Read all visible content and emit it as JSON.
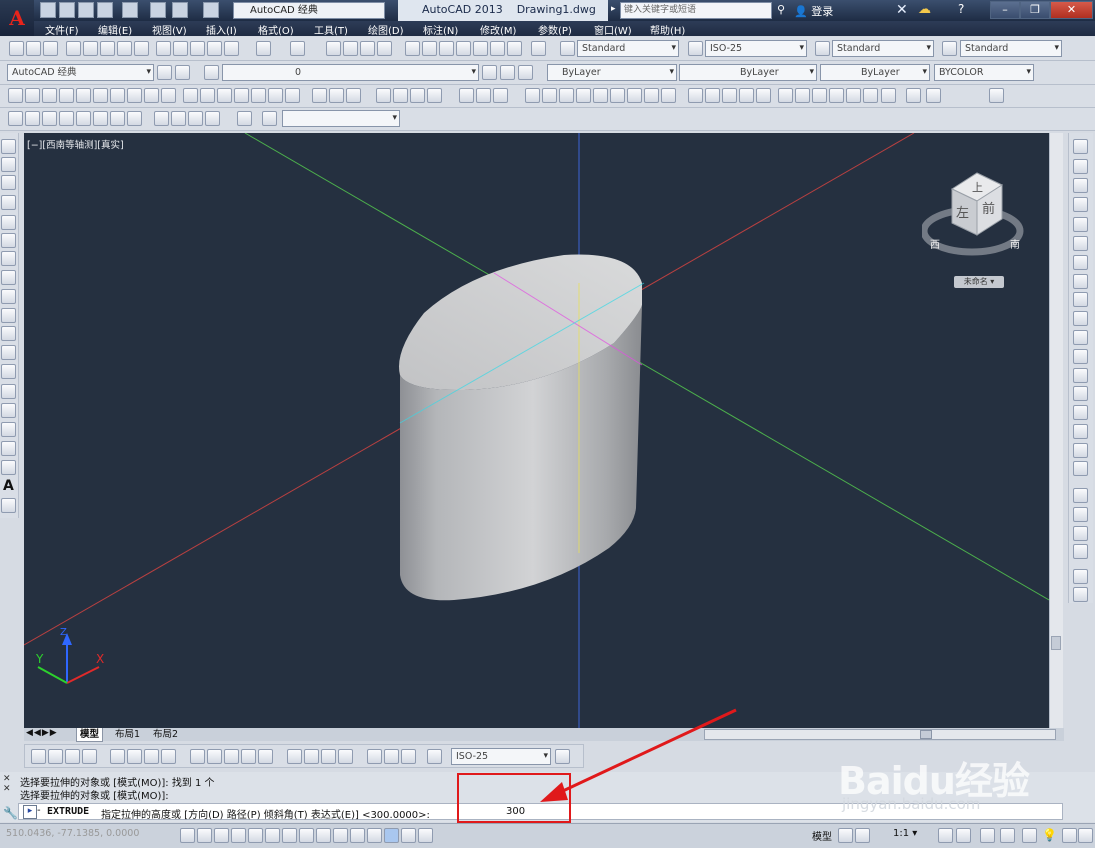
{
  "titlebar": {
    "workspace_combo": "AutoCAD 经典",
    "app_title": "AutoCAD 2013    Drawing1.dwg",
    "search_placeholder": "键入关键字或短语",
    "login": "登录"
  },
  "menubar": {
    "items": [
      "文件(F)",
      "编辑(E)",
      "视图(V)",
      "插入(I)",
      "格式(O)",
      "工具(T)",
      "绘图(D)",
      "标注(N)",
      "修改(M)",
      "参数(P)",
      "窗口(W)",
      "帮助(H)"
    ]
  },
  "styles_toolbar": {
    "text_style": "Standard",
    "dim_style": "ISO-25",
    "table_style": "Standard",
    "multileader_style": "Standard"
  },
  "layers_toolbar": {
    "workspace": "AutoCAD 经典",
    "layer": "0",
    "color": "ByLayer",
    "linetype": "ByLayer",
    "lineweight": "ByLayer",
    "plotstyle": "BYCOLOR"
  },
  "viewport": {
    "label": "[−][西南等轴测][真实]",
    "viewcube": {
      "top": "上",
      "left": "左",
      "front": "前",
      "compass_w": "西",
      "compass_s": "南",
      "ucs": "未命名 ▾"
    },
    "ucs_axes": {
      "x": "X",
      "y": "Y",
      "z": "Z"
    }
  },
  "layout_tabs": [
    "模型",
    "布局1",
    "布局2"
  ],
  "dim_toolbar": {
    "dim_style": "ISO-25"
  },
  "command": {
    "history": [
      "选择要拉伸的对象或 [模式(MO)]: 找到 1 个",
      "选择要拉伸的对象或 [模式(MO)]:"
    ],
    "prompt_cmd": "EXTRUDE",
    "prompt_text": "指定拉伸的高度或 [方向(D) 路径(P) 倾斜角(T) 表达式(E)] <300.0000>:",
    "input_value": "300"
  },
  "statusbar": {
    "coords": "510.0436, -77.1385, 0.0000",
    "model_label": "模型",
    "scale": "1:1 ▾"
  },
  "watermark": {
    "brand": "Baidu经验",
    "url": "jingyan.baidu.com"
  },
  "colors": {
    "viewport_bg": "#253040",
    "highlight_box": "#e0191b",
    "arrow": "#e0191b"
  }
}
